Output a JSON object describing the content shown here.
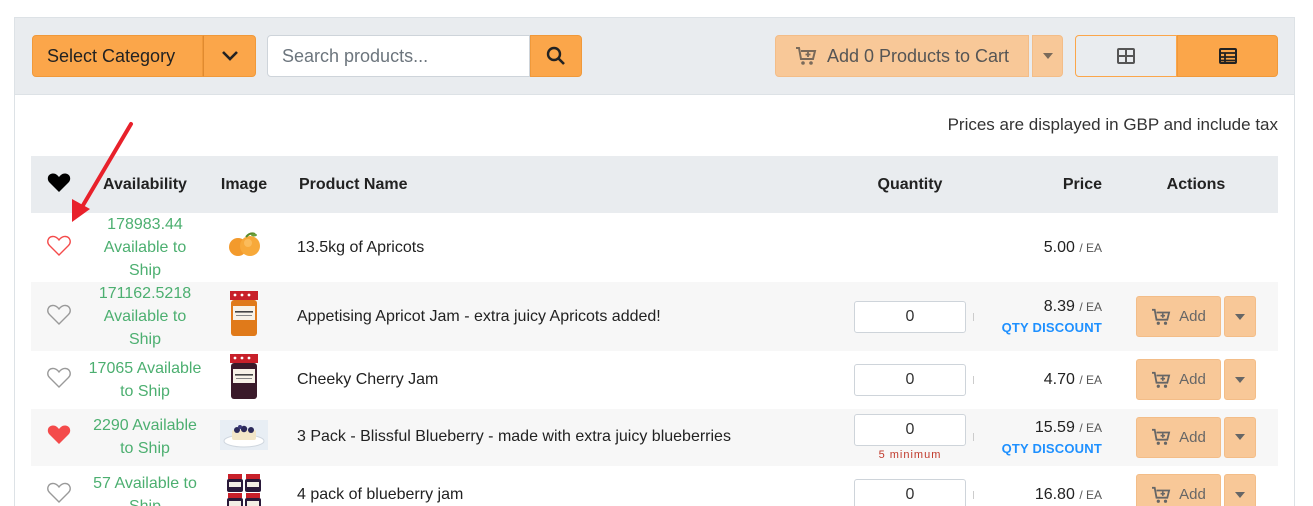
{
  "toolbar": {
    "category_label": "Select Category",
    "search_placeholder": "Search products...",
    "add_to_cart_label": "Add 0 Products to Cart"
  },
  "price_note": "Prices are displayed in GBP and include tax",
  "table": {
    "headers": {
      "availability": "Availability",
      "image": "Image",
      "product_name": "Product Name",
      "quantity": "Quantity",
      "price": "Price",
      "actions": "Actions"
    },
    "rows": [
      {
        "favorite": "outline-red",
        "availability_lines": [
          "178983.44",
          "Available to Ship"
        ],
        "image": "apricots-icon",
        "name": "13.5kg of Apricots",
        "quantity": "",
        "price": "5.00",
        "unit": "/ EA",
        "qty_discount": "",
        "min_note": "",
        "has_actions": false
      },
      {
        "favorite": "outline",
        "availability_lines": [
          "171162.5218",
          "Available to",
          "Ship"
        ],
        "image": "apricot-jam-jar",
        "name": "Appetising Apricot Jam - extra juicy Apricots added!",
        "quantity": "0",
        "price": "8.39",
        "unit": "/ EA",
        "qty_discount": "QTY DISCOUNT",
        "min_note": "",
        "has_actions": true
      },
      {
        "favorite": "outline",
        "availability_lines": [
          "17065 Available",
          "to Ship"
        ],
        "image": "cherry-jam-jar",
        "name": "Cheeky Cherry Jam",
        "quantity": "0",
        "price": "4.70",
        "unit": "/ EA",
        "qty_discount": "",
        "min_note": "",
        "has_actions": true
      },
      {
        "favorite": "filled",
        "availability_lines": [
          "2290 Available",
          "to Ship"
        ],
        "image": "blueberry-dessert",
        "name": "3 Pack - Blissful Blueberry - made with extra juicy blueberries",
        "quantity": "0",
        "price": "15.59",
        "unit": "/ EA",
        "qty_discount": "QTY DISCOUNT",
        "min_note": "5 minimum",
        "has_actions": true
      },
      {
        "favorite": "outline",
        "availability_lines": [
          "57 Available to",
          "Ship"
        ],
        "image": "blueberry-jam-4pack",
        "name": "4 pack of blueberry jam",
        "quantity": "0",
        "price": "16.80",
        "unit": "/ EA",
        "qty_discount": "",
        "min_note": "",
        "has_actions": true
      }
    ],
    "add_label": "Add"
  },
  "colors": {
    "accent": "#fba64a",
    "accent_light": "#f8c898",
    "available": "#4caf70",
    "heart_red": "#f44b4b",
    "discount": "#1e90ff",
    "annotation": "#e8212b"
  }
}
